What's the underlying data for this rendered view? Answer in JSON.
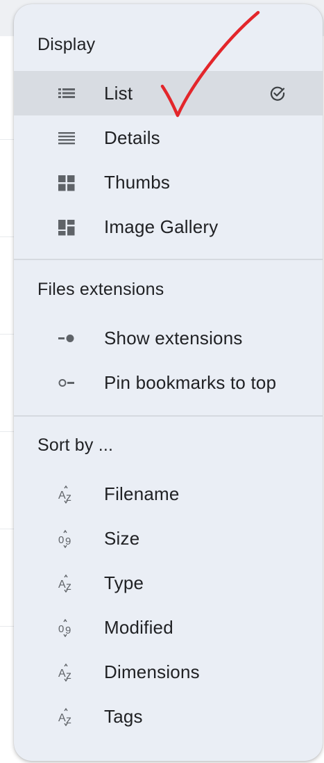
{
  "display": {
    "title": "Display",
    "items": [
      {
        "label": "List",
        "icon": "list-view-icon",
        "selected": true
      },
      {
        "label": "Details",
        "icon": "details-view-icon"
      },
      {
        "label": "Thumbs",
        "icon": "thumbs-view-icon"
      },
      {
        "label": "Image Gallery",
        "icon": "image-gallery-view-icon"
      }
    ]
  },
  "files_extensions": {
    "title": "Files extensions",
    "items": [
      {
        "label": "Show extensions",
        "icon": "toggle-on-icon"
      },
      {
        "label": "Pin bookmarks to top",
        "icon": "toggle-off-icon"
      }
    ]
  },
  "sort_by": {
    "title": "Sort by ...",
    "items": [
      {
        "label": "Filename",
        "icon": "sort-alpha-icon"
      },
      {
        "label": "Size",
        "icon": "sort-numeric-icon"
      },
      {
        "label": "Type",
        "icon": "sort-alpha-icon"
      },
      {
        "label": "Modified",
        "icon": "sort-numeric-icon"
      },
      {
        "label": "Dimensions",
        "icon": "sort-alpha-icon"
      },
      {
        "label": "Tags",
        "icon": "sort-alpha-icon"
      }
    ]
  },
  "colors": {
    "menu_background": "#eaeef5",
    "selected_background": "#d8dce2",
    "annotation_checkmark": "#e3262b"
  }
}
